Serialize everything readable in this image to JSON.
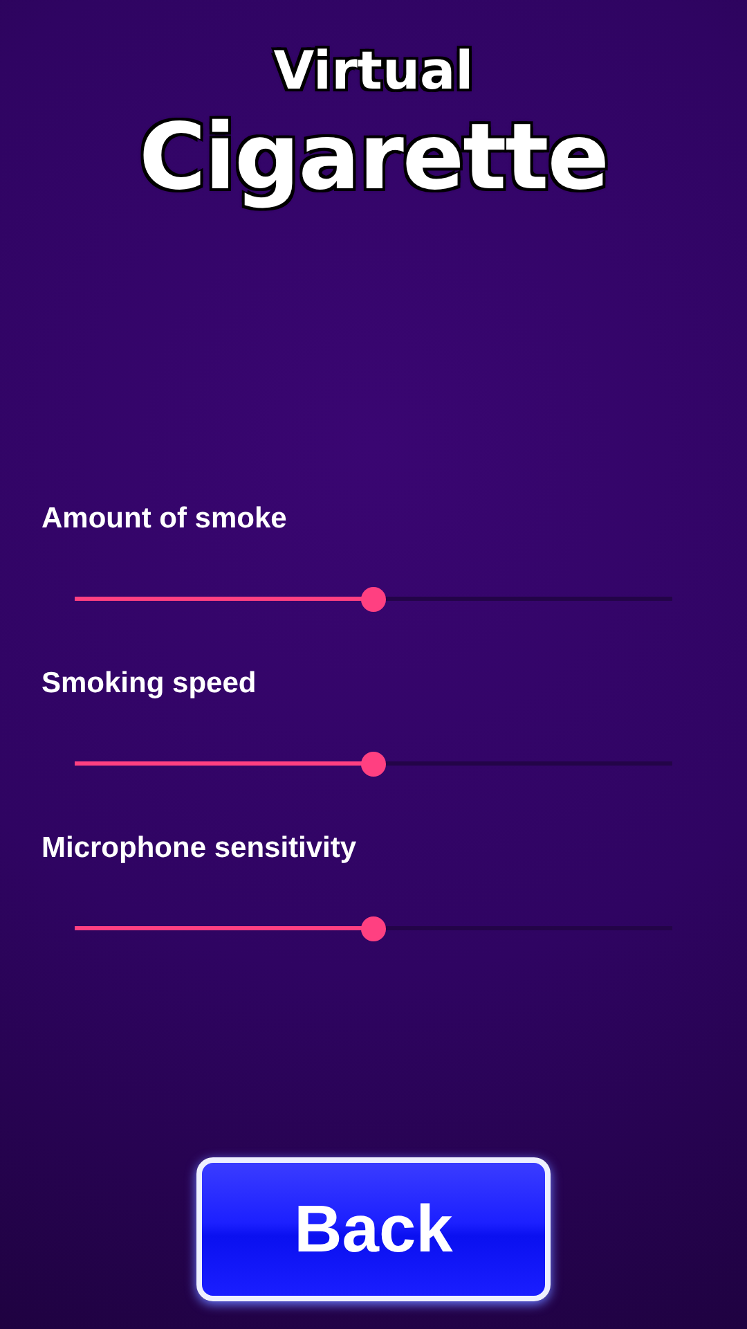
{
  "title": {
    "line_1": "Virtual",
    "line_2": "Cigarette"
  },
  "settings": [
    {
      "label": "Amount of smoke",
      "level": 0.5
    },
    {
      "label": "Smoking speed",
      "level": 0.5
    },
    {
      "label": "Microphone sensitivity",
      "level": 0.5
    }
  ],
  "button": "Back"
}
